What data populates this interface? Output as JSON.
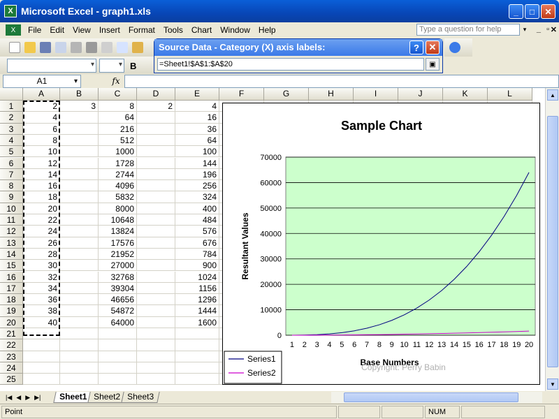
{
  "window": {
    "title": "Microsoft Excel - graph1.xls",
    "app_icon": "X"
  },
  "menu": [
    "File",
    "Edit",
    "View",
    "Insert",
    "Format",
    "Tools",
    "Chart",
    "Window",
    "Help"
  ],
  "help_placeholder": "Type a question for help",
  "namebox": "A1",
  "formula": "",
  "fx_label": "fx",
  "dialog": {
    "title": "Source Data - Category (X) axis labels:",
    "value": "=Sheet1!$A$1:$A$20",
    "help_label": "?",
    "close_label": "✕"
  },
  "columns": [
    "A",
    "B",
    "C",
    "D",
    "E",
    "F",
    "G",
    "H",
    "I",
    "J",
    "K",
    "L"
  ],
  "rows": [
    [
      "2",
      "3",
      "8",
      "2",
      "4"
    ],
    [
      "4",
      "",
      "64",
      "",
      "16"
    ],
    [
      "6",
      "",
      "216",
      "",
      "36"
    ],
    [
      "8",
      "",
      "512",
      "",
      "64"
    ],
    [
      "10",
      "",
      "1000",
      "",
      "100"
    ],
    [
      "12",
      "",
      "1728",
      "",
      "144"
    ],
    [
      "14",
      "",
      "2744",
      "",
      "196"
    ],
    [
      "16",
      "",
      "4096",
      "",
      "256"
    ],
    [
      "18",
      "",
      "5832",
      "",
      "324"
    ],
    [
      "20",
      "",
      "8000",
      "",
      "400"
    ],
    [
      "22",
      "",
      "10648",
      "",
      "484"
    ],
    [
      "24",
      "",
      "13824",
      "",
      "576"
    ],
    [
      "26",
      "",
      "17576",
      "",
      "676"
    ],
    [
      "28",
      "",
      "21952",
      "",
      "784"
    ],
    [
      "30",
      "",
      "27000",
      "",
      "900"
    ],
    [
      "32",
      "",
      "32768",
      "",
      "1024"
    ],
    [
      "34",
      "",
      "39304",
      "",
      "1156"
    ],
    [
      "36",
      "",
      "46656",
      "",
      "1296"
    ],
    [
      "38",
      "",
      "54872",
      "",
      "1444"
    ],
    [
      "40",
      "",
      "64000",
      "",
      "1600"
    ],
    [
      "",
      "",
      "",
      "",
      ""
    ],
    [
      "",
      "",
      "",
      "",
      ""
    ],
    [
      "",
      "",
      "",
      "",
      ""
    ],
    [
      "",
      "",
      "",
      "",
      ""
    ],
    [
      "",
      "",
      "",
      "",
      ""
    ]
  ],
  "row_numbers": [
    "1",
    "2",
    "3",
    "4",
    "5",
    "6",
    "7",
    "8",
    "9",
    "10",
    "11",
    "12",
    "13",
    "14",
    "15",
    "16",
    "17",
    "18",
    "19",
    "20",
    "21",
    "22",
    "23",
    "24",
    "25"
  ],
  "sheets": [
    "Sheet1",
    "Sheet2",
    "Sheet3"
  ],
  "status": {
    "mode": "Point",
    "num": "NUM"
  },
  "chart_data": {
    "type": "line",
    "title": "Sample Chart",
    "xlabel": "Base Numbers",
    "ylabel": "Resultant Values",
    "categories": [
      "1",
      "2",
      "3",
      "4",
      "5",
      "6",
      "7",
      "8",
      "9",
      "10",
      "11",
      "12",
      "13",
      "14",
      "15",
      "16",
      "17",
      "18",
      "19",
      "20"
    ],
    "ylim": [
      0,
      70000
    ],
    "yticks": [
      "0",
      "10000",
      "20000",
      "30000",
      "40000",
      "50000",
      "60000",
      "70000"
    ],
    "series": [
      {
        "name": "Series1",
        "color": "#000080",
        "values": [
          8,
          64,
          216,
          512,
          1000,
          1728,
          2744,
          4096,
          5832,
          8000,
          10648,
          13824,
          17576,
          21952,
          27000,
          32768,
          39304,
          46656,
          54872,
          64000
        ]
      },
      {
        "name": "Series2",
        "color": "#cc00cc",
        "values": [
          4,
          16,
          36,
          64,
          100,
          144,
          196,
          256,
          324,
          400,
          484,
          576,
          676,
          784,
          900,
          1024,
          1156,
          1296,
          1444,
          1600
        ]
      }
    ],
    "plot_background": "#ccffcc",
    "grid": true,
    "legend": "bottom-left",
    "watermark": "Copyright: Perry Babin"
  }
}
